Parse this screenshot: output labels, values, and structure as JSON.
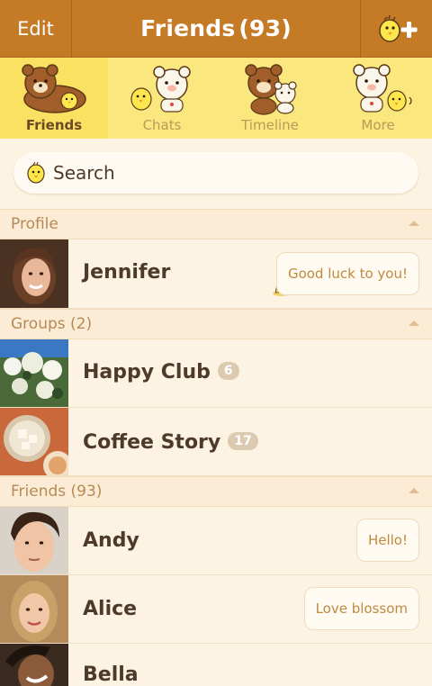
{
  "header": {
    "edit_label": "Edit",
    "title": "Friends",
    "count": "(93)",
    "add_icon": "chick-plus-icon"
  },
  "tabs": [
    {
      "label": "Friends",
      "active": true,
      "icon": "bear-chick-icon"
    },
    {
      "label": "Chats",
      "active": false,
      "icon": "chick-white-bear-icon"
    },
    {
      "label": "Timeline",
      "active": false,
      "icon": "bears-icon"
    },
    {
      "label": "More",
      "active": false,
      "icon": "white-bear-chick-icon"
    }
  ],
  "search": {
    "placeholder": "Search",
    "icon": "chick-icon"
  },
  "profile_section": {
    "label": "Profile"
  },
  "profile": {
    "name": "Jennifer",
    "status": "Good luck to you!",
    "decoration": "pudding-icon"
  },
  "groups_section": {
    "label": "Groups (2)"
  },
  "groups": [
    {
      "name": "Happy Club",
      "count": "6"
    },
    {
      "name": "Coffee Story",
      "count": "17"
    }
  ],
  "friends_section": {
    "label": "Friends (93)"
  },
  "friends": [
    {
      "name": "Andy",
      "status": "Hello!"
    },
    {
      "name": "Alice",
      "status": "Love blossom"
    },
    {
      "name": "Bella",
      "status": ""
    }
  ],
  "colors": {
    "header": "#c57a26",
    "tabbar": "#fae77e",
    "background": "#fdf3e2",
    "accent_text": "#c08a3e"
  }
}
